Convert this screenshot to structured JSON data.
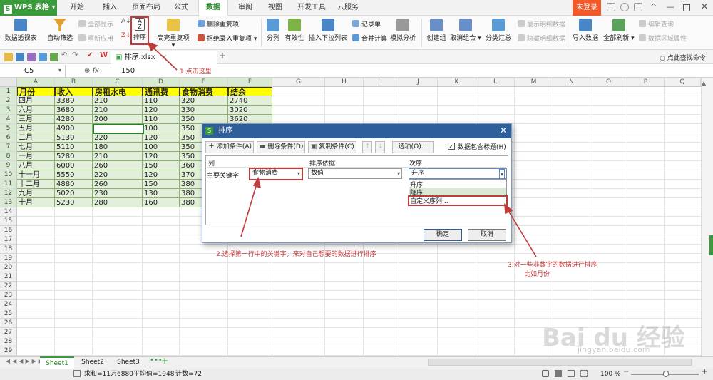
{
  "app": {
    "brand": "WPS 表格",
    "login": "未登录"
  },
  "menu": [
    "开始",
    "插入",
    "页面布局",
    "公式",
    "数据",
    "审阅",
    "视图",
    "开发工具",
    "云服务"
  ],
  "ribbon": {
    "pivot": "数据透视表",
    "autofilter": "自动筛选",
    "showall": "全部显示",
    "reapply": "重新应用",
    "sort": "排序",
    "highlight_dup": "高亮重复项",
    "remove_dup": "删除重复项",
    "reject_dup": "拒绝录入重复项",
    "split": "分列",
    "validity": "有效性",
    "insert_dropdown": "插入下拉列表",
    "record": "记录单",
    "merge_calc": "合并计算",
    "simulate": "模拟分析",
    "group": "创建组",
    "ungroup": "取消组合",
    "subtotal": "分类汇总",
    "show_detail": "显示明细数据",
    "hide_detail": "隐藏明细数据",
    "import": "导入数据",
    "refresh_all": "全部刷新",
    "edit_query": "编辑查询",
    "range_attr": "数据区域属性"
  },
  "file_tab": "排序.xlsx",
  "find_cmd": "点此查找命令",
  "namebox": "C5",
  "fx": "fx",
  "formula_value": "150",
  "columns": [
    "A",
    "B",
    "C",
    "D",
    "E",
    "F",
    "G",
    "H",
    "I",
    "J",
    "K",
    "L",
    "M",
    "N",
    "O",
    "P",
    "Q"
  ],
  "rows": [
    "1",
    "2",
    "3",
    "4",
    "5",
    "6",
    "7",
    "8",
    "9",
    "10",
    "11",
    "12",
    "13",
    "14",
    "15",
    "16",
    "17",
    "18",
    "19",
    "20",
    "21",
    "22",
    "23",
    "24",
    "25",
    "26",
    "27",
    "28",
    "29"
  ],
  "table": {
    "headers": [
      "月份",
      "收入",
      "房租水电",
      "通讯费",
      "食物消费",
      "结余"
    ],
    "rows": [
      [
        "四月",
        "3380",
        "210",
        "110",
        "320",
        "2740"
      ],
      [
        "六月",
        "3680",
        "210",
        "120",
        "330",
        "3020"
      ],
      [
        "三月",
        "4280",
        "200",
        "110",
        "350",
        "3620"
      ],
      [
        "五月",
        "4900",
        "150",
        "100",
        "350",
        ""
      ],
      [
        "二月",
        "5130",
        "220",
        "120",
        "350",
        ""
      ],
      [
        "七月",
        "5110",
        "180",
        "100",
        "350",
        ""
      ],
      [
        "一月",
        "5280",
        "210",
        "120",
        "350",
        ""
      ],
      [
        "八月",
        "6000",
        "260",
        "150",
        "360",
        ""
      ],
      [
        "十一月",
        "5550",
        "220",
        "120",
        "370",
        ""
      ],
      [
        "十二月",
        "4880",
        "260",
        "150",
        "380",
        ""
      ],
      [
        "九月",
        "5020",
        "230",
        "130",
        "380",
        ""
      ],
      [
        "十月",
        "5230",
        "280",
        "160",
        "380",
        ""
      ]
    ]
  },
  "dialog": {
    "title": "排序",
    "add": "添加条件(A)",
    "delete": "删除条件(D)",
    "copy": "复制条件(C)",
    "options": "选项(O)...",
    "has_header": "数据包含标题(H)",
    "col_label": "列",
    "basis_label": "排序依据",
    "order_label": "次序",
    "main_key": "主要关键字",
    "key_value": "食物消费",
    "basis_value": "数值",
    "order_value": "升序",
    "order_options": [
      "升序",
      "降序",
      "自定义序列..."
    ],
    "ok": "确定",
    "cancel": "取消"
  },
  "annotations": {
    "a1": "1.点击这里",
    "a2": "2.选择第一行中的关键字，来对自己想要的数据进行排序",
    "a3_line1": "3.对一些非数字的数据进行排序",
    "a3_line2": "比如月份"
  },
  "sheets": [
    "Sheet1",
    "Sheet2",
    "Sheet3"
  ],
  "status": {
    "sum": "求和=11万6880",
    "avg": "平均值=1948",
    "count": "计数=72",
    "zoom": "100 %"
  },
  "watermark": {
    "brand": "Bai du 经验",
    "url": "jingyan.baidu.com"
  },
  "colors": {
    "accent": "#3a9b3a",
    "dialog_title": "#2f5f9a",
    "header_fill": "#ffff00",
    "data_fill": "#e2efda",
    "annotation": "#c23a3a"
  }
}
